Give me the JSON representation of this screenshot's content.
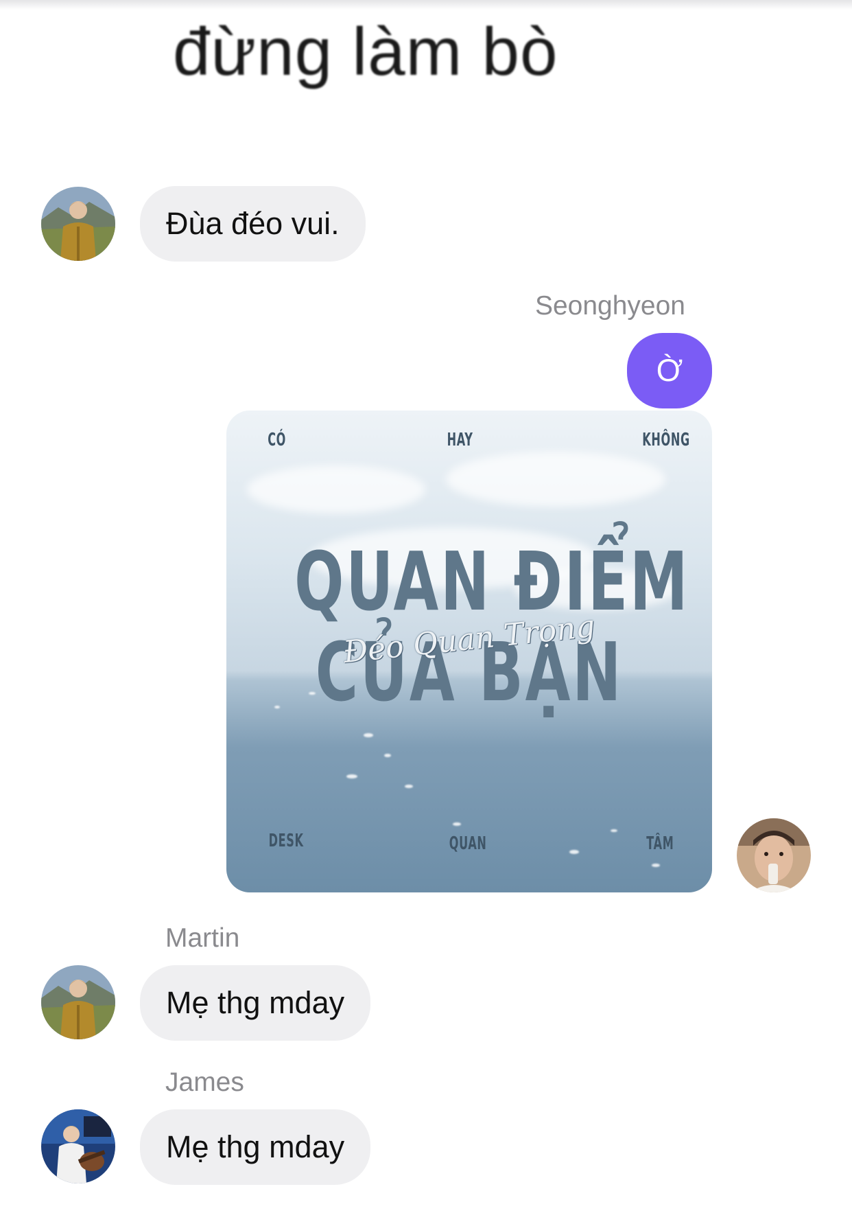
{
  "meme_caption": "đừng làm bò",
  "messages": [
    {
      "sender": "",
      "text": "Đùa đéo vui."
    },
    {
      "sender": "Seonghyeon",
      "text": "Ờ"
    },
    {
      "sender": "Martin",
      "text": "Mẹ thg mday"
    },
    {
      "sender": "James",
      "text": "Mẹ thg mday"
    }
  ],
  "shared_image": {
    "top_words": [
      "CÓ",
      "HAY",
      "KHÔNG"
    ],
    "title_line1": "QUAN ĐIỂM",
    "title_line2": "CỦA BẠN",
    "script_text": "Đéo Quan Trọng",
    "bottom_words": [
      "DESK",
      "QUAN",
      "TÂM"
    ]
  },
  "colors": {
    "outgoing_bubble": "#7b5cf5",
    "incoming_bubble": "#efeff1",
    "sender_name": "#8a8a8e"
  },
  "icons": {
    "avatar_1": "user-avatar-outdoor-jacket",
    "avatar_2": "user-avatar-self",
    "avatar_3": "user-avatar-guitar"
  }
}
